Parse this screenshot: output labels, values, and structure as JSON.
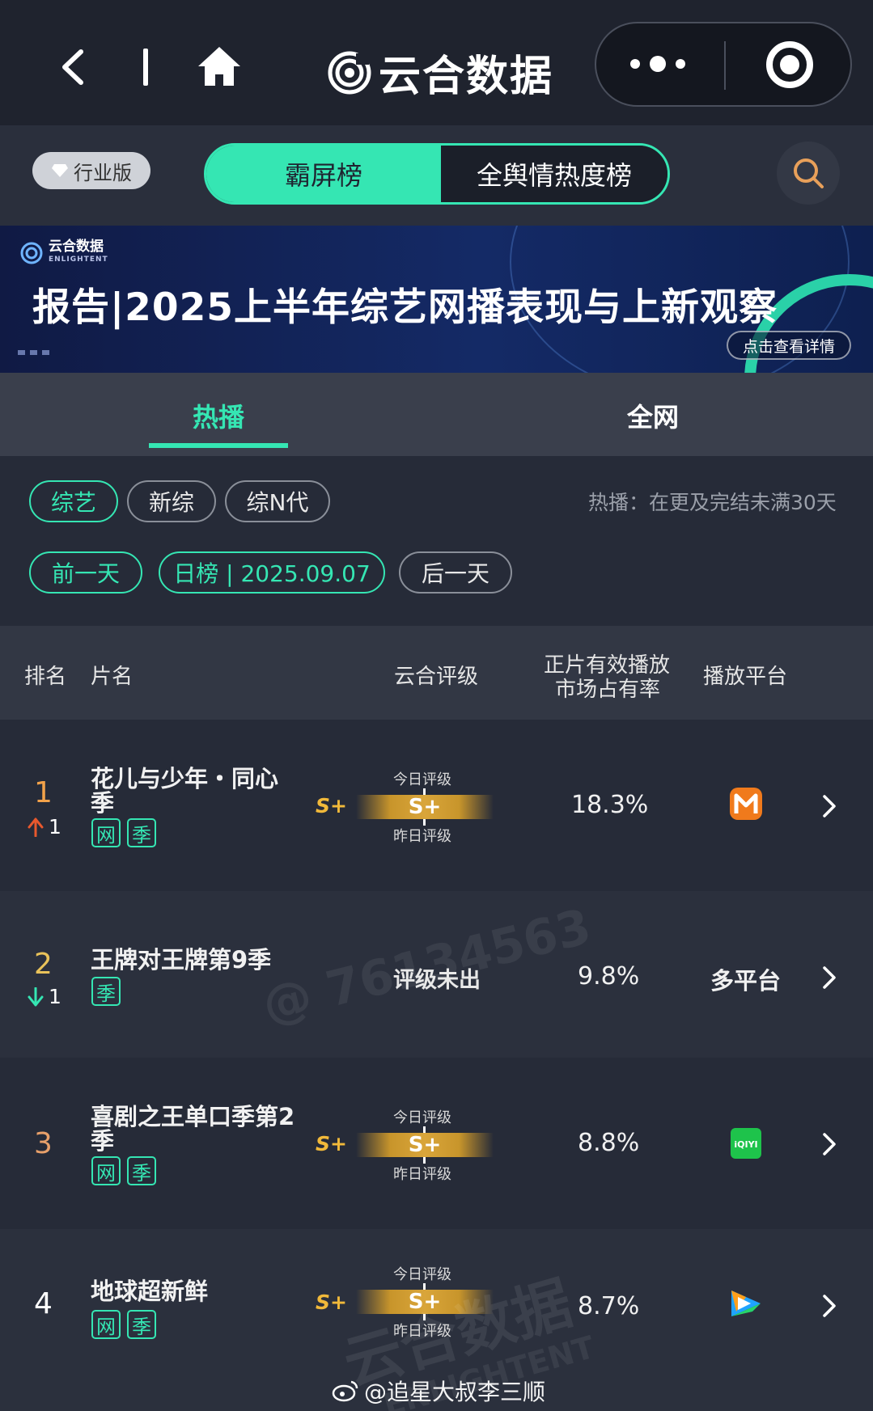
{
  "topbar": {
    "title": "云合数据",
    "icons": [
      "back-arrow-icon",
      "home-icon",
      "brand-logo-icon",
      "more-dots-icon",
      "target-icon"
    ]
  },
  "toolbar": {
    "edition_label": "行业版",
    "tabs": [
      {
        "label": "霸屏榜",
        "active": true
      },
      {
        "label": "全舆情热度榜",
        "active": false
      }
    ]
  },
  "banner": {
    "logo_text": "云合数据",
    "logo_sub": "ENLIGHTENT",
    "headline": "报告|2025上半年综艺网播表现与上新观察",
    "cta": "点击查看详情"
  },
  "main_tabs": [
    {
      "label": "热播",
      "active": true
    },
    {
      "label": "全网",
      "active": false
    }
  ],
  "filters": {
    "categories": [
      {
        "label": "综艺",
        "active": true
      },
      {
        "label": "新综",
        "active": false
      },
      {
        "label": "综N代",
        "active": false
      }
    ],
    "note": "热播：在更及完结未满30天",
    "prev_day": "前一天",
    "date_label": "日榜 | 2025.09.07",
    "next_day": "后一天"
  },
  "table": {
    "headers": {
      "rank": "排名",
      "title": "片名",
      "rating": "云合评级",
      "share_line1": "正片有效播放",
      "share_line2": "市场占有率",
      "platform": "播放平台"
    },
    "rows": [
      {
        "rank": "1",
        "change_dir": "up",
        "change": "1",
        "title": "花儿与少年・同心季",
        "tags": [
          "网",
          "季"
        ],
        "grade": "S+",
        "today_label": "今日评级",
        "today_grade": "S+",
        "yesterday_label": "昨日评级",
        "share": "18.3%",
        "platform": "mango-tv-icon"
      },
      {
        "rank": "2",
        "change_dir": "down",
        "change": "1",
        "title": "王牌对王牌第9季",
        "tags": [
          "季"
        ],
        "rating_text": "评级未出",
        "share": "9.8%",
        "platform_text": "多平台"
      },
      {
        "rank": "3",
        "title": "喜剧之王单口季第2季",
        "tags": [
          "网",
          "季"
        ],
        "grade": "S+",
        "today_label": "今日评级",
        "today_grade": "S+",
        "yesterday_label": "昨日评级",
        "share": "8.8%",
        "platform": "iqiyi-icon",
        "platform_label": "iQIYI"
      },
      {
        "rank": "4",
        "title": "地球超新鲜",
        "tags": [
          "网",
          "季"
        ],
        "grade": "S+",
        "today_label": "今日评级",
        "today_grade": "S+",
        "yesterday_label": "昨日评级",
        "share": "8.7%",
        "platform": "tencent-video-icon"
      }
    ]
  },
  "watermarks": {
    "id_text": "@ 76134563",
    "brand_text": "云合数据",
    "brand_sub": "ENLIGHTENT"
  },
  "credit": "@追星大叔李三顺",
  "colors": {
    "accent": "#35e6b3",
    "up": "#e8582d",
    "down": "#35e6b3",
    "grade": "#f1b93a",
    "rank1": "#f2a24a",
    "rank3": "#e8a06a"
  }
}
